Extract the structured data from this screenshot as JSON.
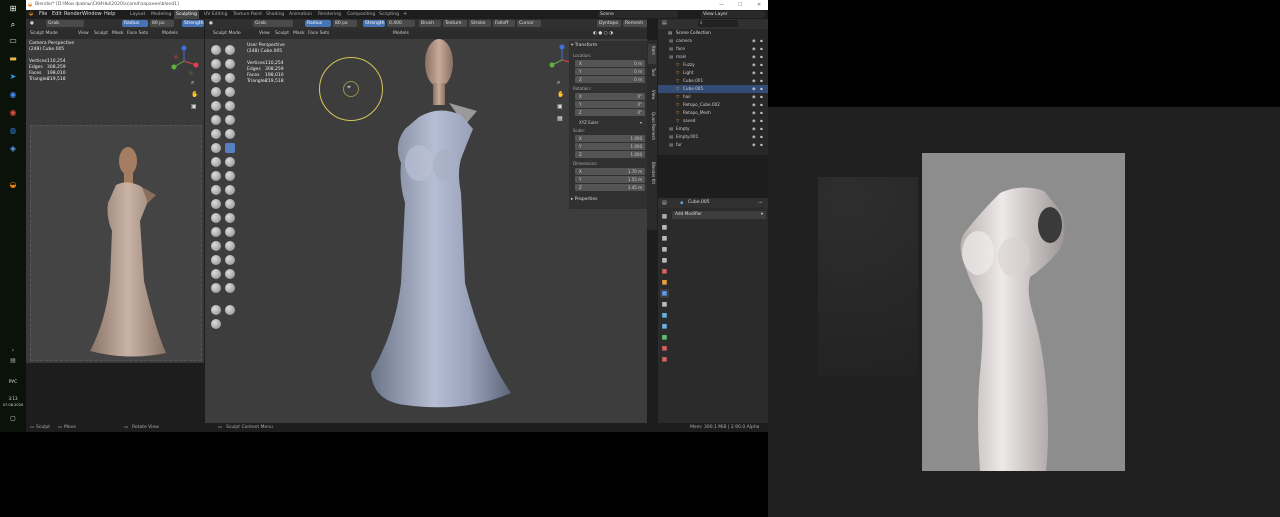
{
  "title": "Blender* [D:\\Мои файлы\\СКИНЫ\\2020\\scared\\заранее\\blend1]",
  "taskbar": {
    "lang": "РУС",
    "time": "3:13",
    "date": "07.08.2020"
  },
  "menu": [
    "File",
    "Edit",
    "Render",
    "Window",
    "Help"
  ],
  "workspaces": [
    "Layout",
    "Modeling",
    "Sculpting",
    "UV Editing",
    "Texture Paint",
    "Shading",
    "Animation",
    "Rendering",
    "Compositing",
    "Scripting"
  ],
  "active_workspace": "Sculpting",
  "scene": "Scene",
  "view_layer": "View Layer",
  "left_viewport": {
    "brush": "Grab",
    "radius_label": "Radius",
    "radius_value": "80 px",
    "strength_label": "Strength",
    "mode": "Sculpt Mode",
    "menus": [
      "View",
      "Sculpt",
      "Mask",
      "Face Sets"
    ],
    "models_label": "Models",
    "view_title": "Camera Perspective",
    "object": "(248) Cube.005",
    "stats": [
      {
        "label": "Vertices",
        "value": "110,254"
      },
      {
        "label": "Edges",
        "value": "308,259"
      },
      {
        "label": "Faces",
        "value": "198,010"
      },
      {
        "label": "Triangles",
        "value": "219,518"
      }
    ]
  },
  "main_viewport": {
    "brush": "Grab",
    "radius_label": "Radius",
    "radius_value": "80 px",
    "strength_label": "Strength",
    "strength_value": "0.400",
    "header_right": [
      "Brush",
      "Texture",
      "Stroke",
      "Falloff",
      "Cursor"
    ],
    "dyntopo": "Dyntopo",
    "remesh": "Remesh",
    "mode": "Sculpt Mode",
    "menus": [
      "View",
      "Sculpt",
      "Mask",
      "Face Sets"
    ],
    "models_label": "Models",
    "view_title": "User Perspective",
    "object": "(248) Cube.005",
    "stats": [
      {
        "label": "Vertices",
        "value": "110,254"
      },
      {
        "label": "Edges",
        "value": "308,259"
      },
      {
        "label": "Faces",
        "value": "198,010"
      },
      {
        "label": "Triangles",
        "value": "219,518"
      }
    ]
  },
  "transform": {
    "title": "Transform",
    "location_label": "Location:",
    "location": [
      {
        "axis": "X",
        "value": "0 m"
      },
      {
        "axis": "Y",
        "value": "0 m"
      },
      {
        "axis": "Z",
        "value": "0 m"
      }
    ],
    "rotation_label": "Rotation:",
    "rotation": [
      {
        "axis": "X",
        "value": "0°"
      },
      {
        "axis": "Y",
        "value": "0°"
      },
      {
        "axis": "Z",
        "value": "0°"
      }
    ],
    "rotation_mode": "XYZ Euler",
    "scale_label": "Scale:",
    "scale": [
      {
        "axis": "X",
        "value": "1.000"
      },
      {
        "axis": "Y",
        "value": "1.000"
      },
      {
        "axis": "Z",
        "value": "1.000"
      }
    ],
    "dimensions_label": "Dimensions:",
    "dimensions": [
      {
        "axis": "X",
        "value": "1.70 m"
      },
      {
        "axis": "Y",
        "value": "1.55 m"
      },
      {
        "axis": "Z",
        "value": "3.45 m"
      }
    ],
    "properties_label": "Properties"
  },
  "side_tabs": [
    "Item",
    "Tool",
    "View",
    "Quad Remesh",
    "Blender Kit"
  ],
  "outliner": {
    "title": "Scene Collection",
    "rows": [
      {
        "name": "camera",
        "indent": 1,
        "selected": false
      },
      {
        "name": "face",
        "indent": 1,
        "selected": false
      },
      {
        "name": "main",
        "indent": 1,
        "selected": false
      },
      {
        "name": "Fuzzy",
        "indent": 2,
        "selected": false
      },
      {
        "name": "Light",
        "indent": 2,
        "selected": false
      },
      {
        "name": "Cube.001",
        "indent": 2,
        "selected": false
      },
      {
        "name": "Cube.005",
        "indent": 2,
        "selected": true
      },
      {
        "name": "hair",
        "indent": 2,
        "selected": false
      },
      {
        "name": "Retopo_Cube.002",
        "indent": 2,
        "selected": false
      },
      {
        "name": "Retopo_Mesh",
        "indent": 2,
        "selected": false
      },
      {
        "name": "saved",
        "indent": 2,
        "selected": false
      },
      {
        "name": "Empty",
        "indent": 1,
        "selected": false
      },
      {
        "name": "Empty.001",
        "indent": 1,
        "selected": false
      },
      {
        "name": "fur",
        "indent": 1,
        "selected": false
      }
    ]
  },
  "properties": {
    "object": "Cube.005",
    "add_modifier": "Add Modifier"
  },
  "statusbar": {
    "left": "Sculpt",
    "mid": "Move",
    "rotate": "Rotate View",
    "menu": "Sculpt Context Menu",
    "info": "Mem: 300.1 MiB | 2.90.0 Alpha"
  },
  "colors": {
    "accent": "#4772b3",
    "selection": "#334c75",
    "brush_circle": "#d4c75a"
  }
}
